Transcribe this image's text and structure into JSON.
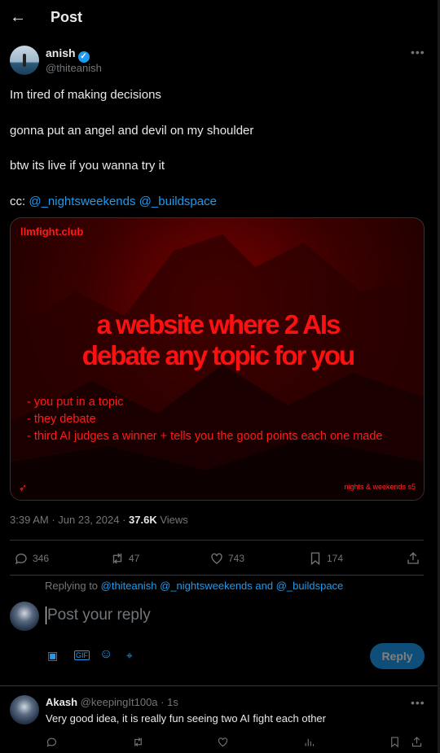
{
  "header": {
    "title": "Post",
    "back_icon": "arrow-left-icon"
  },
  "post": {
    "author": {
      "name": "anish",
      "handle": "@thiteanish",
      "verified": true
    },
    "lines": [
      "Im tired of making decisions",
      "gonna put an angel and devil on my shoulder",
      "btw its live if you wanna try it"
    ],
    "cc_prefix": "cc: ",
    "mentions": [
      "@_nightsweekends",
      "@_buildspace"
    ],
    "card": {
      "site": "llmfight.club",
      "headline_1": "a website where 2 AIs",
      "headline_2": "debate any topic for you",
      "bullets": [
        "- you put in a topic",
        "- they debate",
        "- third AI judges a winner + tells you the good points each one made"
      ],
      "footer": "nights & weekends s5",
      "accent": "#ff1a1a"
    },
    "time": "3:39 AM",
    "date": "Jun 23, 2024",
    "views": "37.6K",
    "views_label": "Views",
    "stats": {
      "replies": "346",
      "reposts": "47",
      "likes": "743",
      "bookmarks": "174"
    }
  },
  "reply_box": {
    "replying_to_label": "Replying to",
    "replying_to": "@thiteanish @_nightsweekends and @_buildspace",
    "placeholder": "Post your reply",
    "button": "Reply"
  },
  "comment": {
    "name": "Akash",
    "handle": "@keepingIt100a",
    "time": "· 1s",
    "text": "Very good idea, it is really fun seeing two AI fight each other"
  },
  "colors": {
    "accent": "#1d9bf0",
    "background": "#000000"
  }
}
